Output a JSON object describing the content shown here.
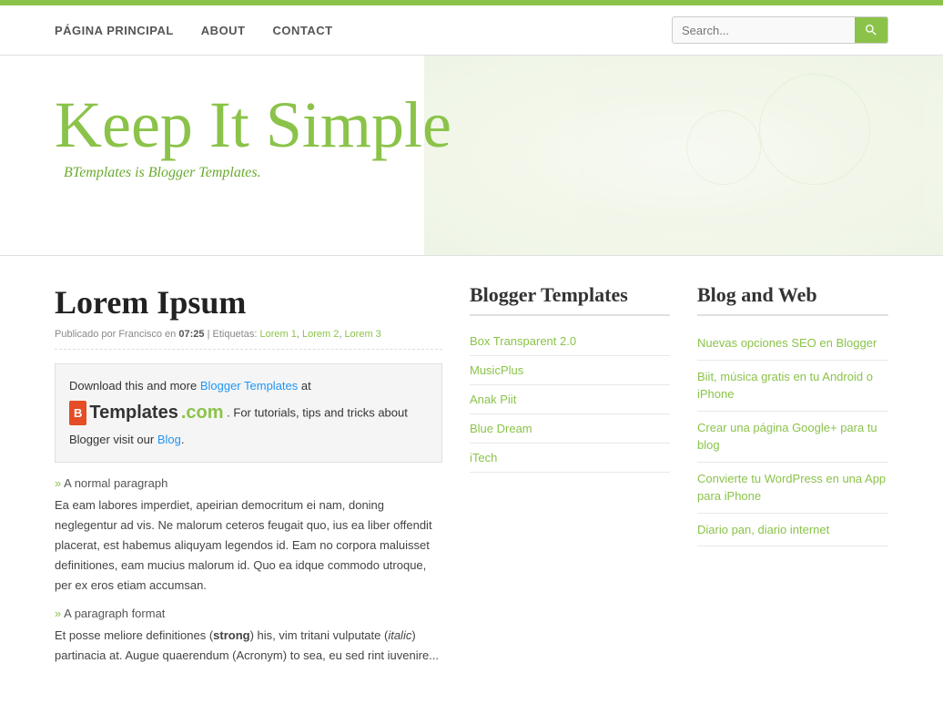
{
  "topBorder": {},
  "nav": {
    "links": [
      {
        "id": "pagina-principal",
        "label": "PÁGINA PRINCIPAL",
        "href": "#"
      },
      {
        "id": "about",
        "label": "ABOUT",
        "href": "#"
      },
      {
        "id": "contact",
        "label": "CONTACT",
        "href": "#"
      }
    ],
    "search": {
      "placeholder": "Search...",
      "button_label": "Search"
    }
  },
  "header": {
    "site_title": "Keep It Simple",
    "site_subtitle": "BTemplates is Blogger Templates."
  },
  "post": {
    "title": "Lorem Ipsum",
    "meta": {
      "published_by": "Publicado por Francisco en",
      "time": "07:25",
      "etiquetas_label": "Etiquetas:",
      "tags": [
        "Lorem 1",
        "Lorem 2",
        "Lorem 3"
      ]
    },
    "download_text": "Download this and more",
    "download_link_text": "Blogger Templates",
    "download_at": "at",
    "btemplates_prefix": "B",
    "btemplates_main": "Templates",
    "btemplates_domain": ".com",
    "btemplates_suffix": ". For tutorials, tips and tricks about Blogger visit our",
    "blog_link_text": "Blog",
    "paragraph1_title": "A normal paragraph",
    "paragraph1_body": "Ea eam labores imperdiet, apeirian democritum ei nam, doning neglegentur ad vis. Ne malorum ceteros feugait quo, ius ea liber offendit placerat, est habemus aliquyam legendos id. Eam no corpora maluisset definitiones, eam mucius malorum id. Quo ea idque commodo utroque, per ex eros etiam accumsan.",
    "paragraph2_title": "A paragraph format",
    "paragraph2_body": "Et posse meliore definitiones (strong) his, vim tritani vulputate (italic) partinacia at. Augue quaerendum (Acronym) to sea, eu sed rint iuvenire..."
  },
  "sidebar1": {
    "title": "Blogger Templates",
    "items": [
      {
        "label": "Box Transparent 2.0",
        "href": "#"
      },
      {
        "label": "MusicPlus",
        "href": "#"
      },
      {
        "label": "Anak Piit",
        "href": "#"
      },
      {
        "label": "Blue Dream",
        "href": "#"
      },
      {
        "label": "iTech",
        "href": "#"
      }
    ]
  },
  "sidebar2": {
    "title": "Blog and Web",
    "items": [
      {
        "label": "Nuevas opciones SEO en Blogger",
        "href": "#"
      },
      {
        "label": "Biit, música gratis en tu Android o iPhone",
        "href": "#"
      },
      {
        "label": "Crear una página Google+ para tu blog",
        "href": "#"
      },
      {
        "label": "Convierte tu WordPress en una App para iPhone",
        "href": "#"
      },
      {
        "label": "Diario pan, diario internet",
        "href": "#"
      }
    ]
  }
}
